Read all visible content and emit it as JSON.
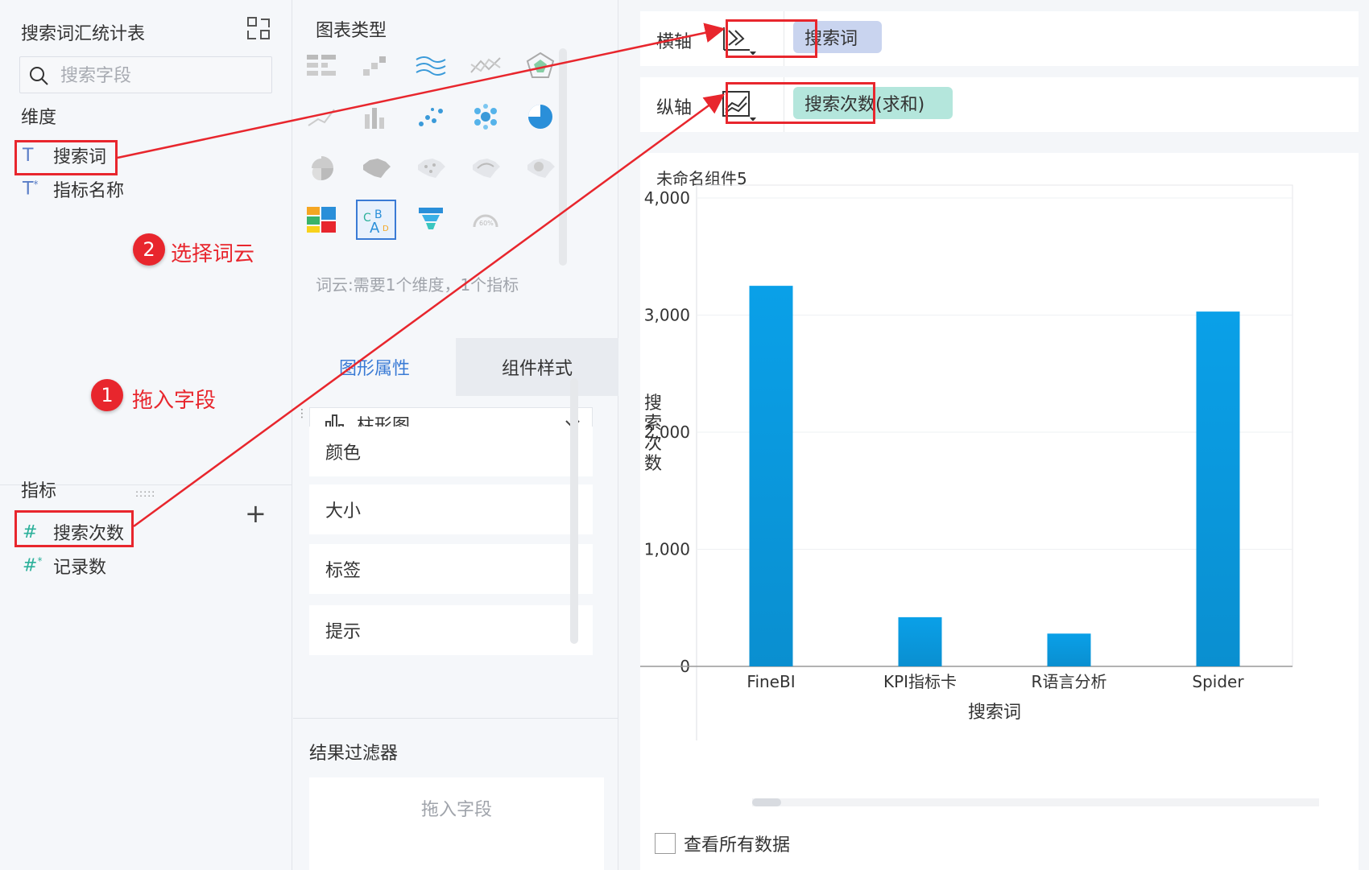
{
  "left": {
    "title": "搜索词汇统计表",
    "search_placeholder": "搜索字段",
    "dimensions_label": "维度",
    "dimensions": [
      {
        "icon": "T",
        "label": "搜索词"
      },
      {
        "icon": "T*",
        "label": "指标名称"
      }
    ],
    "metrics_label": "指标",
    "metrics": [
      {
        "icon": "#",
        "label": "搜索次数"
      },
      {
        "icon": "#*",
        "label": "记录数"
      }
    ]
  },
  "annotations": {
    "step1_num": "1",
    "step1_text": "拖入字段",
    "step2_num": "2",
    "step2_text": "选择词云",
    "color": "#e8262d"
  },
  "middle": {
    "title": "图表类型",
    "hint": "词云:需要1个维度，1个指标",
    "tabs": [
      "图形属性",
      "组件样式"
    ],
    "chart_select": "柱形图",
    "props": [
      "颜色",
      "大小",
      "标签",
      "提示"
    ],
    "filter_title": "结果过滤器",
    "filter_drop": "拖入字段"
  },
  "right": {
    "x_axis_label": "横轴",
    "x_axis_field": "搜索词",
    "y_axis_label": "纵轴",
    "y_axis_field": "搜索次数(求和)",
    "widget_title": "未命名组件5",
    "show_all_label": "查看所有数据"
  },
  "chart_data": {
    "type": "bar",
    "categories": [
      "FineBI",
      "KPI指标卡",
      "R语言分析",
      "Spider"
    ],
    "values": [
      3250,
      420,
      280,
      3030
    ],
    "xlabel": "搜索词",
    "ylabel": "搜索次数",
    "yticks": [
      "0",
      "1,000",
      "2,000",
      "3,000",
      "4,000"
    ],
    "ylim": [
      0,
      4000
    ],
    "bar_color": "#0aa0e8"
  }
}
